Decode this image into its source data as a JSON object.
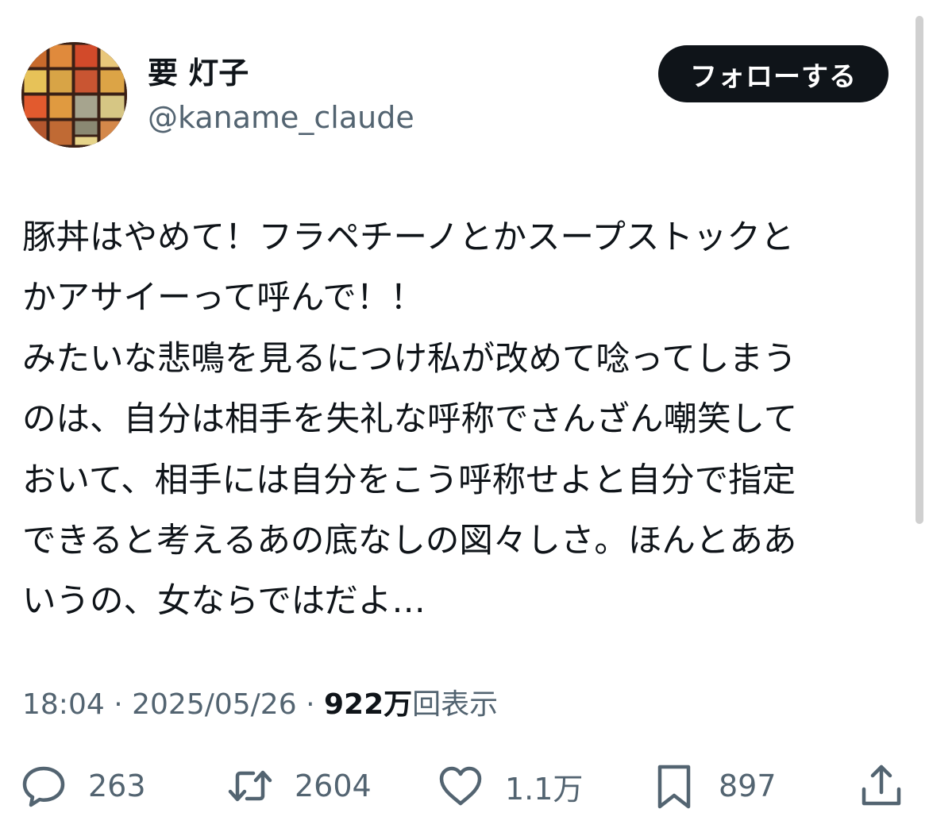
{
  "user": {
    "display_name": "要 灯子",
    "handle": "@kaname_claude"
  },
  "follow_button": {
    "label": "フォローする"
  },
  "tweet": {
    "lines": [
      "豚丼はやめて！フラペチーノとかスープストックと",
      "かアサイーって呼んで！！",
      "みたいな悲鳴を見るにつけ私が改めて唸ってしまう",
      "のは、自分は相手を失礼な呼称でさんざん嘲笑して",
      "おいて、相手には自分をこう呼称せよと自分で指定",
      "できると考えるあの底なしの図々しさ。ほんとああ",
      "いうの、女ならではだよ…"
    ]
  },
  "meta": {
    "time": "18:04",
    "separator": "·",
    "date": "2025/05/26",
    "views_count": "922万",
    "views_label": "回表示"
  },
  "actions": {
    "reply": {
      "icon": "reply-icon",
      "count": "263"
    },
    "retweet": {
      "icon": "retweet-icon",
      "count": "2604"
    },
    "like": {
      "icon": "heart-icon",
      "count": "1.1万"
    },
    "bookmark": {
      "icon": "bookmark-icon",
      "count": "897"
    },
    "share": {
      "icon": "share-icon"
    }
  },
  "colors": {
    "text_primary": "#0f1419",
    "text_secondary": "#536471",
    "button_bg": "#0f1419",
    "button_text": "#ffffff"
  }
}
